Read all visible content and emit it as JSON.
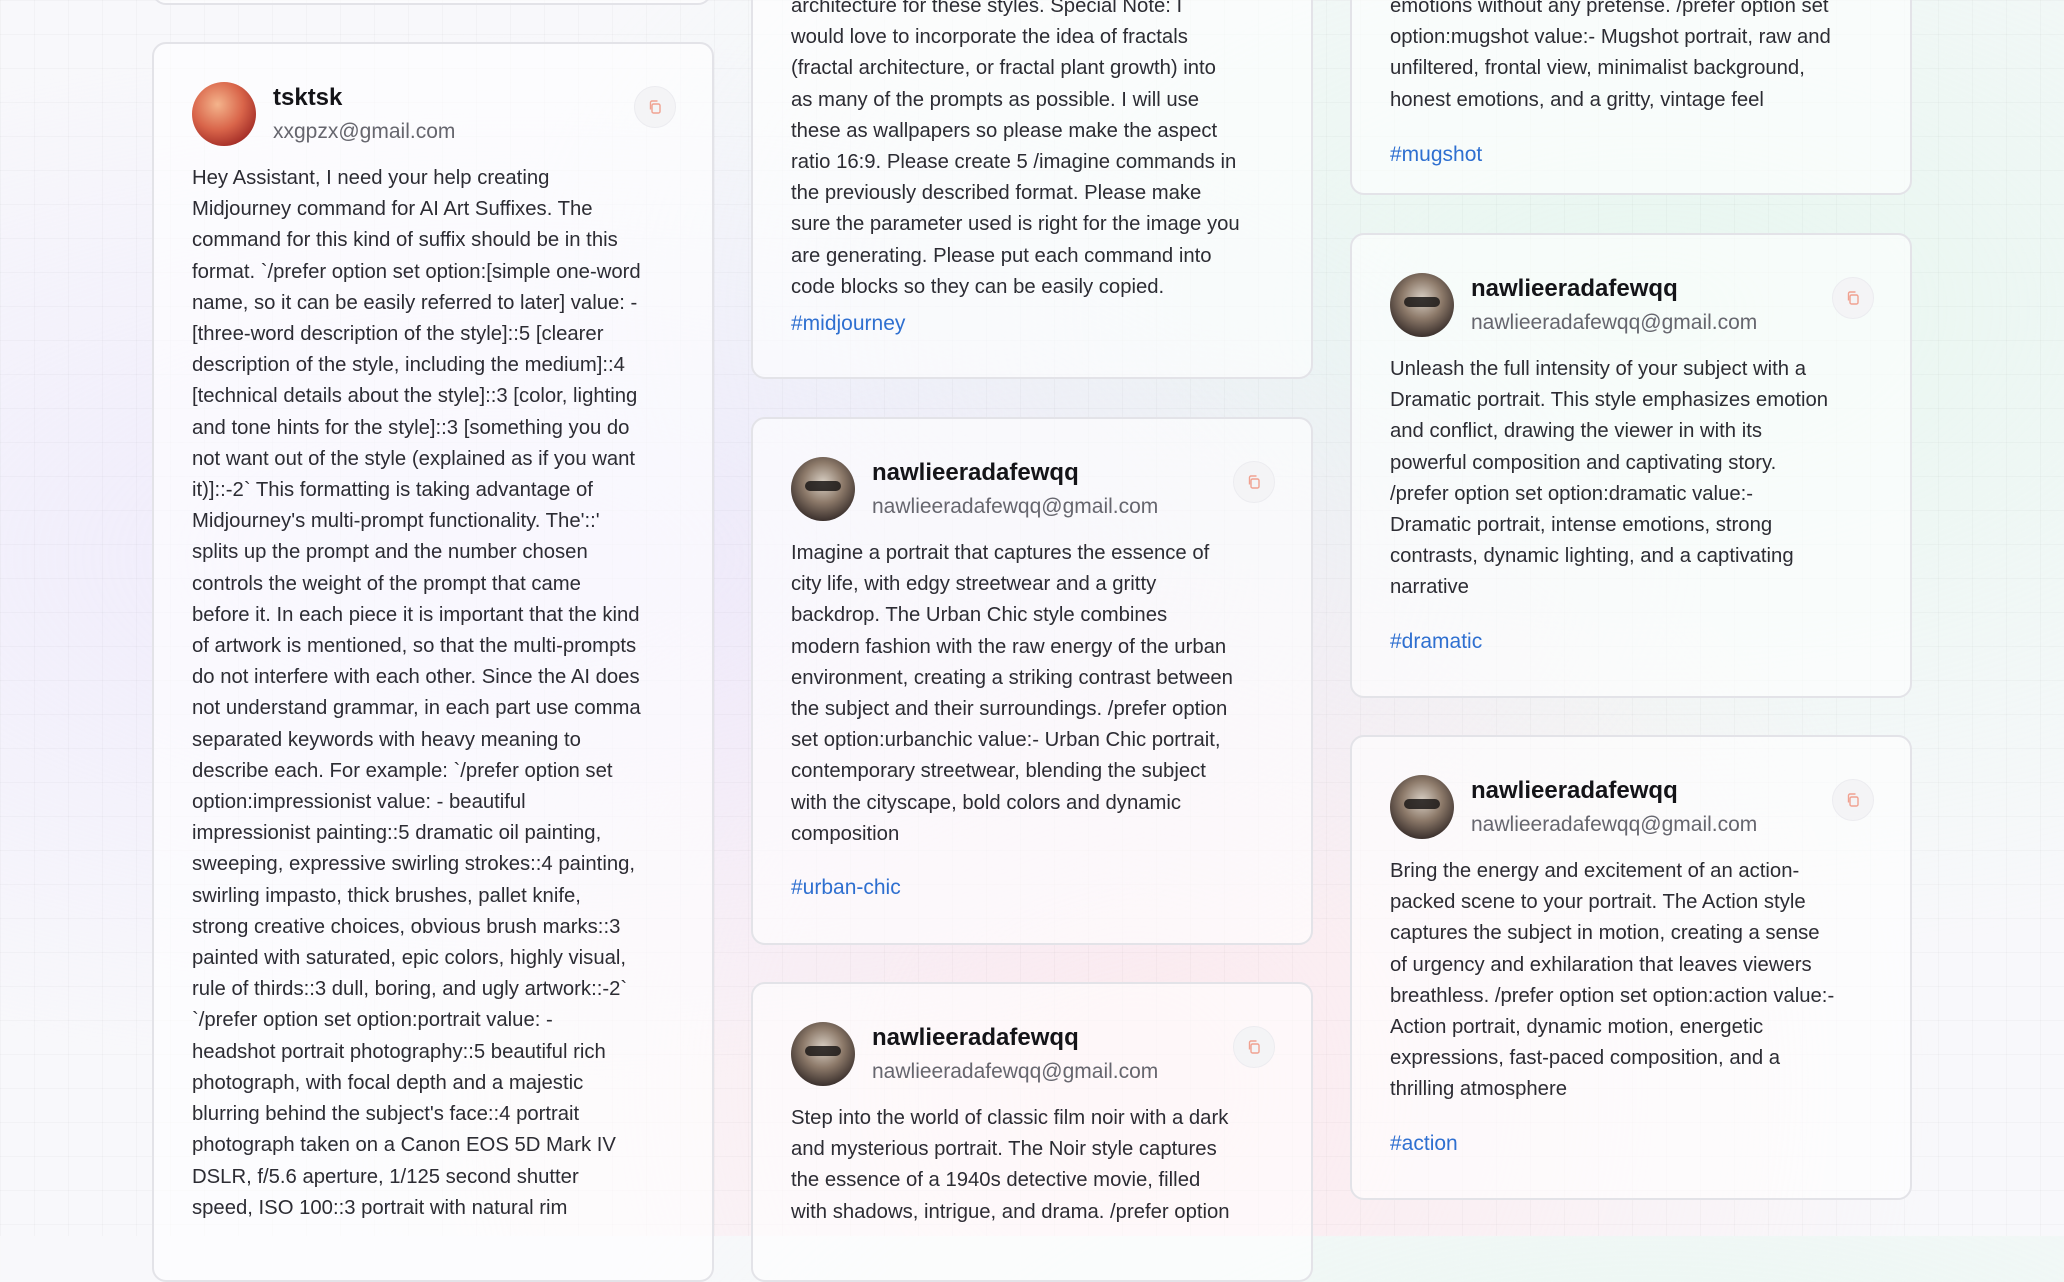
{
  "copy_icon": "copy-icon",
  "colors": {
    "tag": "#2e6fd0",
    "icon": "#f0a190",
    "card_border": "#e3e3e8"
  },
  "col1": {
    "card": {
      "name": "tsktsk",
      "email": "xxgpzx@gmail.com",
      "text": "Hey Assistant, I need your help creating\nMidjourney command for AI Art Suffixes. The\ncommand for this kind of suffix should be in this\nformat. `/prefer option set option:[simple one-word\nname, so it can be easily referred to later] value: -\n[three-word description of the style]::5 [clearer\ndescription of the style, including the medium]::4\n[technical details about the style]::3 [color, lighting\nand tone hints for the style]::3 [something you do\nnot want out of the style (explained as if you want\nit)]::-2` This formatting is taking advantage of\nMidjourney's multi-prompt functionality. The'::'\nsplits up the prompt and the number chosen\ncontrols the weight of the prompt that came\nbefore it. In each piece it is important that the kind\nof artwork is mentioned, so that the multi-prompts\ndo not interfere with each other. Since the AI does\nnot understand grammar, in each part use comma\nseparated keywords with heavy meaning to\ndescribe each. For example: `/prefer option set\noption:impressionist value: - beautiful\nimpressionist painting::5 dramatic oil painting,\nsweeping, expressive swirling strokes::4 painting,\nswirling impasto, thick brushes, pallet knife,\nstrong creative choices, obvious brush marks::3\npainted with saturated, epic colors, highly visual,\nrule of thirds::3 dull, boring, and ugly artwork::-2`\n`/prefer option set option:portrait value: -\nheadshot portrait photography::5 beautiful rich\nphotograph, with focal depth and a majestic\nblurring behind the subject's face::4 portrait\nphotograph taken on a Canon EOS 5D Mark IV\nDSLR, f/5.6 aperture, 1/125 second shutter\nspeed, ISO 100::3 portrait with natural rim"
    }
  },
  "col2": {
    "top": {
      "text": "architecture for these styles. Special Note: I\nwould love to incorporate the idea of fractals\n(fractal architecture, or fractal plant growth) into\nas many of the prompts as possible. I will use\nthese as wallpapers so please make the aspect\nratio 16:9. Please create 5 /imagine commands in\nthe previously described format. Please make\nsure the parameter used is right for the image you\nare generating. Please put each command into\ncode blocks so they can be easily copied.",
      "tag": "#midjourney"
    },
    "cards": [
      {
        "name": "nawlieeradafewqq",
        "email": "nawlieeradafewqq@gmail.com",
        "text": "Imagine a portrait that captures the essence of\ncity life, with edgy streetwear and a gritty\nbackdrop. The Urban Chic style combines\nmodern fashion with the raw energy of the urban\nenvironment, creating a striking contrast between\nthe subject and their surroundings. /prefer option\nset option:urbanchic value:- Urban Chic portrait,\ncontemporary streetwear, blending the subject\nwith the cityscape, bold colors and dynamic\ncomposition",
        "tag": "#urban-chic"
      },
      {
        "name": "nawlieeradafewqq",
        "email": "nawlieeradafewqq@gmail.com",
        "text": "Step into the world of classic film noir with a dark\nand mysterious portrait. The Noir style captures\nthe essence of a 1940s detective movie, filled\nwith shadows, intrigue, and drama. /prefer option"
      }
    ]
  },
  "col3": {
    "top": {
      "text": "emotions without any pretense. /prefer option set\noption:mugshot value:- Mugshot portrait, raw and\nunfiltered, frontal view, minimalist background,\nhonest emotions, and a gritty, vintage feel",
      "tag": "#mugshot"
    },
    "cards": [
      {
        "name": "nawlieeradafewqq",
        "email": "nawlieeradafewqq@gmail.com",
        "text": "Unleash the full intensity of your subject with a\nDramatic portrait. This style emphasizes emotion\nand conflict, drawing the viewer in with its\npowerful composition and captivating story.\n/prefer option set option:dramatic value:-\nDramatic portrait, intense emotions, strong\ncontrasts, dynamic lighting, and a captivating\nnarrative",
        "tag": "#dramatic"
      },
      {
        "name": "nawlieeradafewqq",
        "email": "nawlieeradafewqq@gmail.com",
        "text": "Bring the energy and excitement of an action-\npacked scene to your portrait. The Action style\ncaptures the subject in motion, creating a sense\nof urgency and exhilaration that leaves viewers\nbreathless. /prefer option set option:action value:-\nAction portrait, dynamic motion, energetic\nexpressions, fast-paced composition, and a\nthrilling atmosphere",
        "tag": "#action"
      }
    ]
  }
}
